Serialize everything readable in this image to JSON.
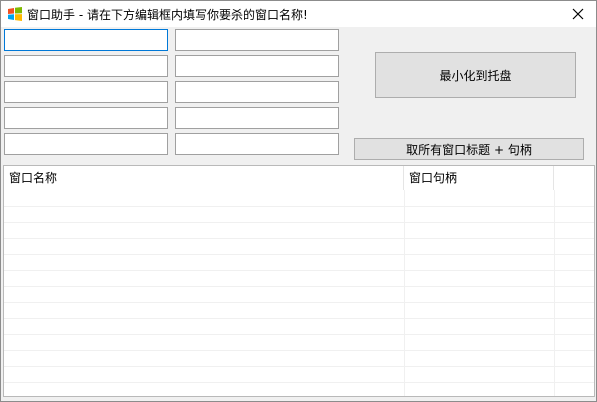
{
  "window": {
    "title": "窗口助手 - 请在下方编辑框内填写你要杀的窗口名称!"
  },
  "inputs": {
    "left": [
      "",
      "",
      "",
      "",
      ""
    ],
    "right": [
      "",
      "",
      "",
      "",
      ""
    ]
  },
  "buttons": {
    "minimize_to_tray": "最小化到托盘",
    "get_all_titles": "取所有窗口标题 + 句柄"
  },
  "listview": {
    "columns": [
      "窗口名称",
      "窗口句柄"
    ],
    "rows": []
  }
}
